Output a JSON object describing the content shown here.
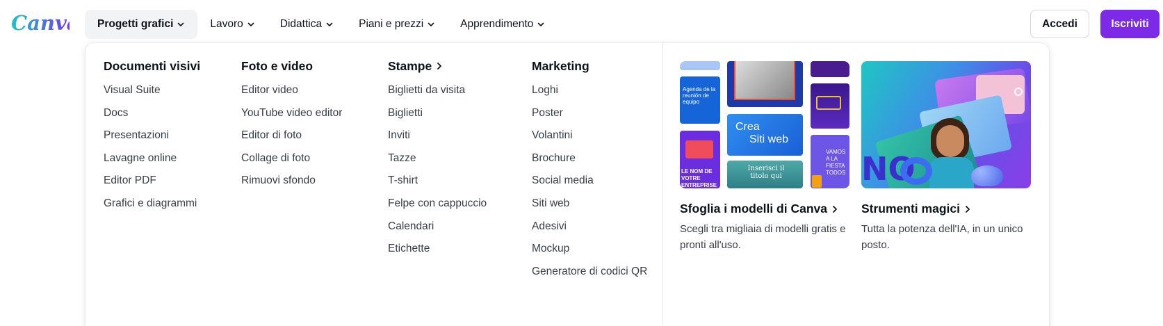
{
  "brand": {
    "logo_text": "Canva",
    "accent": "#7d2ae8",
    "logo_color": "#1fb1cf"
  },
  "nav": {
    "items": [
      {
        "label": "Progetti grafici",
        "active": true
      },
      {
        "label": "Lavoro",
        "active": false
      },
      {
        "label": "Didattica",
        "active": false
      },
      {
        "label": "Piani e prezzi",
        "active": false
      },
      {
        "label": "Apprendimento",
        "active": false
      }
    ]
  },
  "auth": {
    "login_label": "Accedi",
    "signup_label": "Iscriviti"
  },
  "menu": {
    "columns": [
      {
        "title": "Documenti visivi",
        "has_arrow": false,
        "items": [
          "Visual Suite",
          "Docs",
          "Presentazioni",
          "Lavagne online",
          "Editor PDF",
          "Grafici e diagrammi"
        ]
      },
      {
        "title": "Foto e video",
        "has_arrow": false,
        "items": [
          "Editor video",
          "YouTube video editor",
          "Editor di foto",
          "Collage di foto",
          "Rimuovi sfondo"
        ]
      },
      {
        "title": "Stampe",
        "has_arrow": true,
        "items": [
          "Biglietti da visita",
          "Biglietti",
          "Inviti",
          "Tazze",
          "T-shirt",
          "Felpe con cappuccio",
          "Calendari",
          "Etichette"
        ]
      },
      {
        "title": "Marketing",
        "has_arrow": false,
        "items": [
          "Loghi",
          "Poster",
          "Volantini",
          "Brochure",
          "Social media",
          "Siti web",
          "Adesivi",
          "Mockup",
          "Generatore di codici QR"
        ]
      }
    ],
    "promos": [
      {
        "title": "Sfoglia i modelli di Canva",
        "description": "Scegli tra migliaia di modelli gratis e pronti all'uso."
      },
      {
        "title": "Strumenti magici",
        "description": "Tutta la potenza dell'IA, in un unico posto."
      }
    ],
    "template_thumbs": {
      "agenda": "Agenda de la reunión de equipo",
      "crea": "Crea",
      "siti": "Siti web",
      "inserisci": "Inserisci il titolo qui",
      "nom": "LE NOM DE VOTRE ENTREPRISE",
      "vamos": "VAMOS A LA FIESTA TODOS"
    }
  }
}
